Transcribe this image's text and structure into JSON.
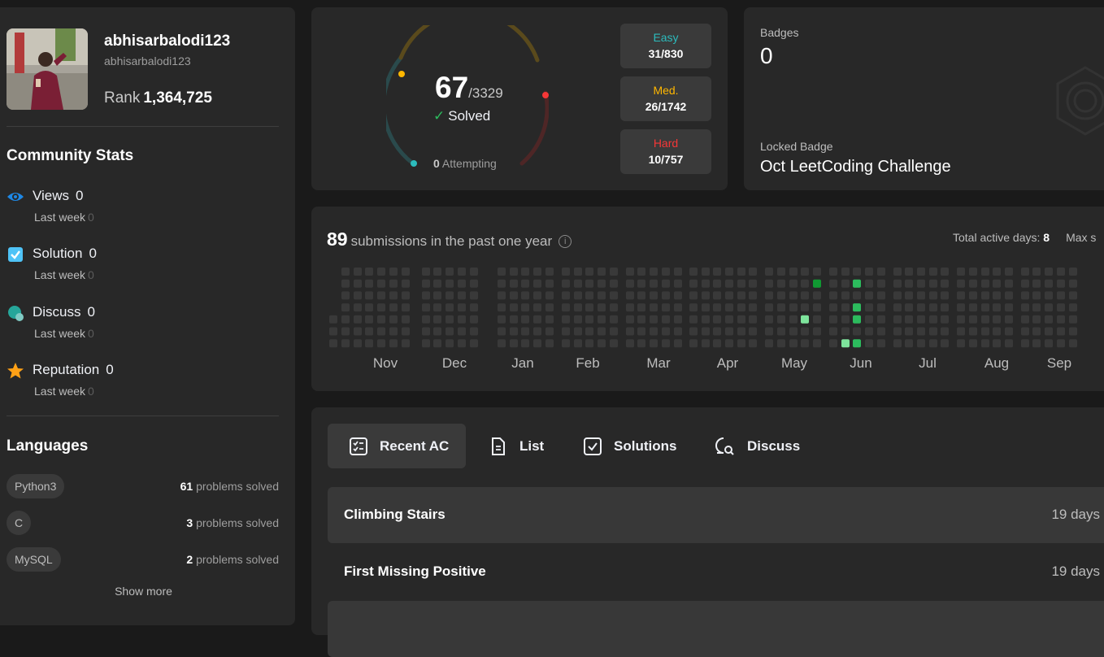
{
  "profile": {
    "name": "abhisarbalodi123",
    "handle": "abhisarbalodi123",
    "rank_label": "Rank",
    "rank_value": "1,364,725"
  },
  "community": {
    "title": "Community Stats",
    "stats": [
      {
        "label": "Views",
        "value": "0",
        "sub_label": "Last week",
        "sub_value": "0",
        "icon": "eye-icon",
        "color": "#1e88e5"
      },
      {
        "label": "Solution",
        "value": "0",
        "sub_label": "Last week",
        "sub_value": "0",
        "icon": "check-square-icon",
        "color": "#4fc3f7"
      },
      {
        "label": "Discuss",
        "value": "0",
        "sub_label": "Last week",
        "sub_value": "0",
        "icon": "chat-bubble-icon",
        "color": "#26a69a"
      },
      {
        "label": "Reputation",
        "value": "0",
        "sub_label": "Last week",
        "sub_value": "0",
        "icon": "star-icon",
        "color": "#ffa116"
      }
    ]
  },
  "languages": {
    "title": "Languages",
    "items": [
      {
        "name": "Python3",
        "count": "61",
        "suffix": "problems solved"
      },
      {
        "name": "C",
        "count": "3",
        "suffix": "problems solved"
      },
      {
        "name": "MySQL",
        "count": "2",
        "suffix": "problems solved"
      }
    ],
    "show_more": "Show more"
  },
  "solved": {
    "count": "67",
    "total": "/3329",
    "label": "Solved",
    "attempting_count": "0",
    "attempting_label": "Attempting",
    "difficulties": [
      {
        "name": "Easy",
        "value": "31/830",
        "color": "#2cbbbc"
      },
      {
        "name": "Med.",
        "value": "26/1742",
        "color": "#ffb700"
      },
      {
        "name": "Hard",
        "value": "10/757",
        "color": "#f63737"
      }
    ]
  },
  "badges": {
    "title": "Badges",
    "count": "0",
    "locked_label": "Locked Badge",
    "locked_name": "Oct LeetCoding Challenge"
  },
  "submissions": {
    "count": "89",
    "label": "submissions in the past one year",
    "active_days_label": "Total active days:",
    "active_days_value": "8",
    "max_streak_label": "Max s",
    "months": [
      "Nov",
      "Dec",
      "Jan",
      "Feb",
      "Mar",
      "Apr",
      "May",
      "Jun",
      "Jul",
      "Aug",
      "Sep"
    ],
    "colors": {
      "empty": "#393939",
      "low": "#7ee49c",
      "mid": "#2cbb5d",
      "high": "#109932"
    }
  },
  "recent": {
    "tabs": [
      {
        "label": "Recent AC",
        "icon": "checklist-icon",
        "active": true
      },
      {
        "label": "List",
        "icon": "document-icon",
        "active": false
      },
      {
        "label": "Solutions",
        "icon": "check-square-icon",
        "active": false
      },
      {
        "label": "Discuss",
        "icon": "search-chat-icon",
        "active": false
      }
    ],
    "items": [
      {
        "title": "Climbing Stairs",
        "time": "19 days"
      },
      {
        "title": "First Missing Positive",
        "time": "19 days"
      }
    ]
  }
}
